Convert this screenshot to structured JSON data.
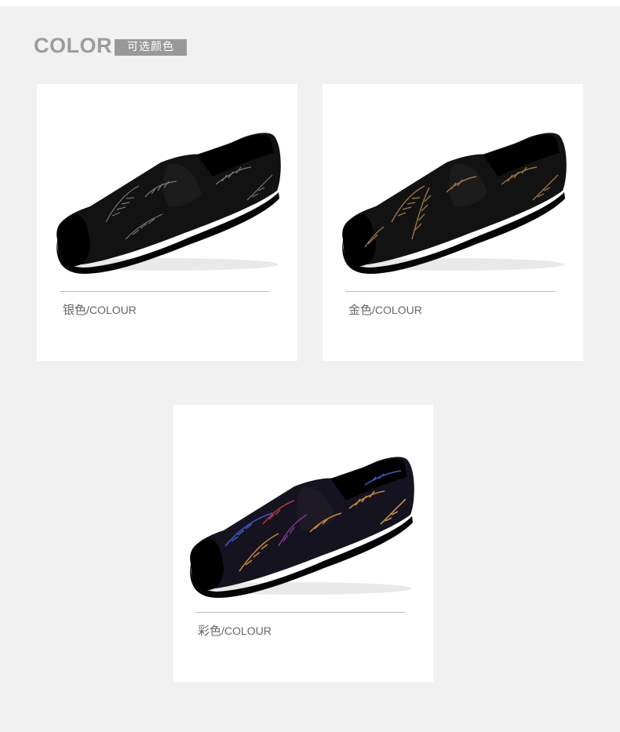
{
  "heading": {
    "title_en": "COLOR",
    "title_cn": "可选颜色"
  },
  "colors": {
    "background": "#f1f1f1",
    "card": "#ffffff",
    "heading_gray": "#9c9c9c",
    "badge_gray": "#999999",
    "caption_text": "#666666"
  },
  "variants": [
    {
      "name": "银色",
      "suffix": "/COLOUR",
      "image": "black-shoe-silver-feather-print",
      "accent": "#8a8a8a"
    },
    {
      "name": "金色",
      "suffix": "/COLOUR",
      "image": "black-shoe-gold-feather-print",
      "accent": "#a07a4e"
    },
    {
      "name": "彩色",
      "suffix": "/COLOUR",
      "image": "black-shoe-multicolor-feather-print",
      "accent": "#c48a3c"
    }
  ]
}
